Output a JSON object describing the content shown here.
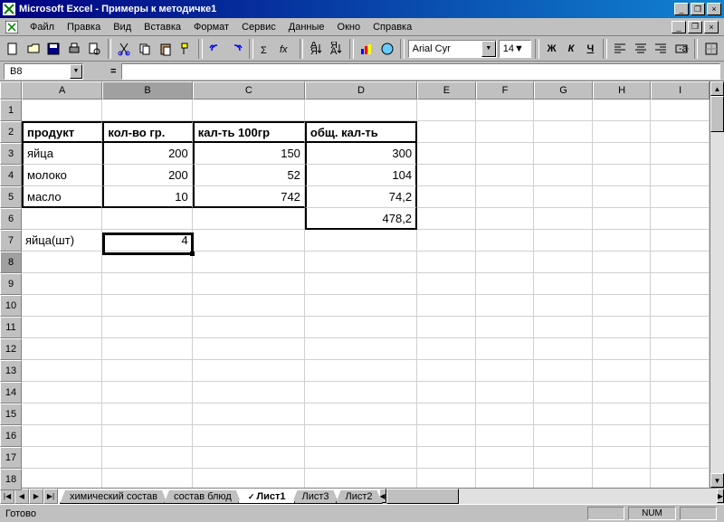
{
  "title": "Microsoft Excel - Примеры к методичке1",
  "menus": [
    "Файл",
    "Правка",
    "Вид",
    "Вставка",
    "Формат",
    "Сервис",
    "Данные",
    "Окно",
    "Справка"
  ],
  "font_name": "Arial Cyr",
  "font_size": "14",
  "format_buttons": {
    "bold": "Ж",
    "italic": "К",
    "underline": "Ч"
  },
  "namebox": "B8",
  "formula_eq": "=",
  "columns": [
    "A",
    "B",
    "C",
    "D",
    "E",
    "F",
    "G",
    "H",
    "I"
  ],
  "row_count": 18,
  "active": {
    "row": 8,
    "col": "B"
  },
  "chart_data": {
    "type": "table",
    "headers": [
      "продукт",
      "кол-во гр.",
      "кал-ть 100гр",
      "общ. кал-ть"
    ],
    "rows": [
      {
        "product": "яйца",
        "qty": 200,
        "cal100": 150,
        "total": 300
      },
      {
        "product": "молоко",
        "qty": 200,
        "cal100": 52,
        "total": 104
      },
      {
        "product": "масло",
        "qty": 10,
        "cal100": 742,
        "total": "74,2"
      }
    ],
    "sum_total": "478,2",
    "extra": {
      "label": "яйца(шт)",
      "value": 4
    }
  },
  "tabs": [
    "химический состав",
    "состав блюд",
    "Лист1",
    "Лист3",
    "Лист2"
  ],
  "active_tab": 2,
  "status": "Готово",
  "indicator": "NUM"
}
